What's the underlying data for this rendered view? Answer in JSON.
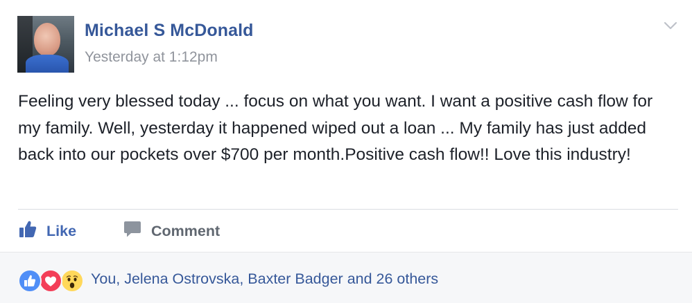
{
  "post": {
    "author": "Michael S McDonald",
    "timestamp": "Yesterday at 1:12pm",
    "text": "Feeling very blessed today ... focus on what you want. I want a positive cash flow for my family. Well, yesterday it happened wiped out a loan ... My family has just added back into our pockets over $700 per month.Positive cash flow!! Love this industry!"
  },
  "actions": {
    "like_label": "Like",
    "comment_label": "Comment"
  },
  "reactions": {
    "icons": [
      "like-reaction-icon",
      "love-reaction-icon",
      "wow-reaction-icon"
    ],
    "summary": "You, Jelena Ostrovska, Baxter Badger and 26 others"
  },
  "colors": {
    "link_blue": "#365899",
    "like_blue": "#4267b2",
    "muted_gray": "#90949c",
    "text": "#1d2129",
    "footer_bg": "#f6f7f9"
  }
}
